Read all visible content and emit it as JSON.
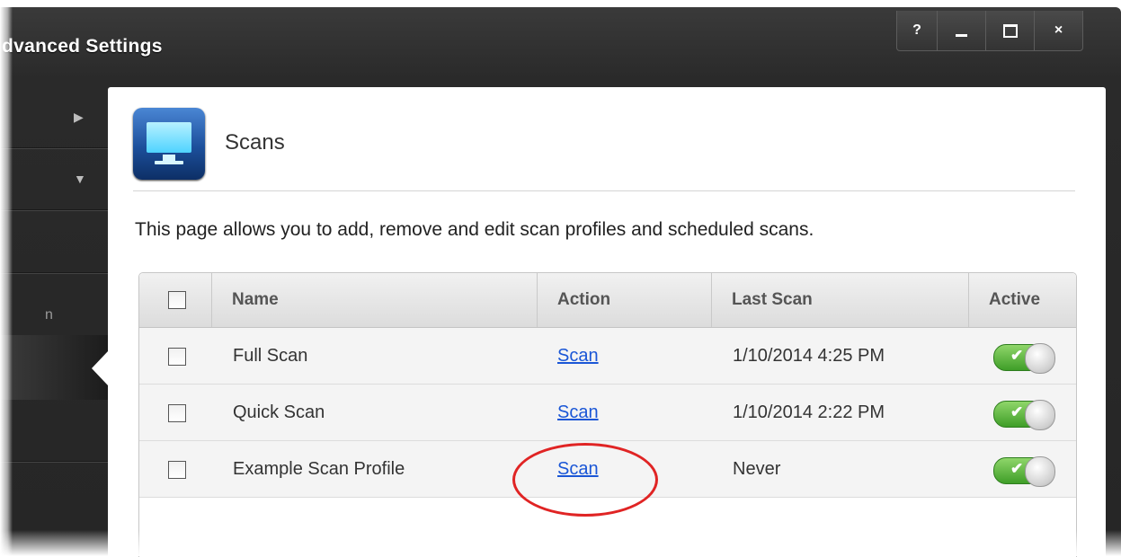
{
  "window": {
    "title": "dvanced Settings",
    "controls": {
      "help": "?",
      "minimize": "minimize",
      "maximize": "maximize",
      "close": "×"
    }
  },
  "sidebar": {
    "expand_arrow_1": "▶",
    "expand_arrow_2": "▼",
    "partial_label": "n"
  },
  "page": {
    "title": "Scans",
    "description": "This page allows you to add, remove and edit scan profiles and scheduled scans."
  },
  "table": {
    "columns": [
      "Name",
      "Action",
      "Last Scan",
      "Active"
    ],
    "rows": [
      {
        "name": "Full Scan",
        "action": "Scan",
        "last_scan": "1/10/2014 4:25 PM",
        "active": true
      },
      {
        "name": "Quick Scan",
        "action": "Scan",
        "last_scan": "1/10/2014 2:22 PM",
        "active": true
      },
      {
        "name": "Example Scan Profile",
        "action": "Scan",
        "last_scan": "Never",
        "active": true
      }
    ]
  },
  "toggle_check": "✔",
  "colors": {
    "accent_link": "#1a56d6",
    "annotation": "#e02424",
    "toggle_on": "#3f9e28"
  }
}
